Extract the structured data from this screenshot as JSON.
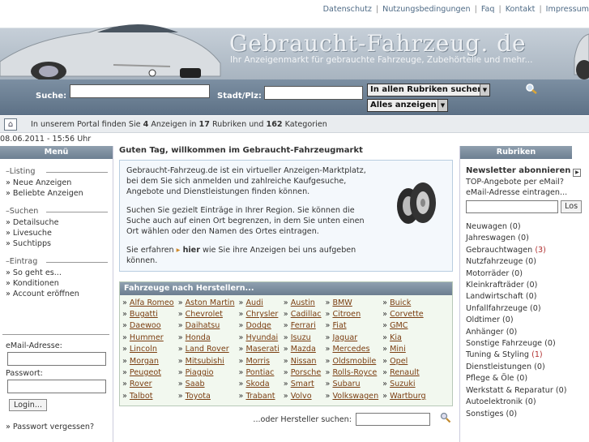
{
  "toplinks": [
    "Datenschutz",
    "Nutzungsbedingungen",
    "Faq",
    "Kontakt",
    "Impressum"
  ],
  "header": {
    "title": "Gebraucht-Fahrzeug. de",
    "subtitle": "Ihr Anzeigenmarkt für gebrauchte Fahrzeuge, Zubehörteile und mehr..."
  },
  "search": {
    "label": "Suche:",
    "city_label": "Stadt/Plz:",
    "rubric_select": "In allen Rubriken suchen",
    "show_select": "Alles anzeigen"
  },
  "info": {
    "pre": "In unserem Portal finden Sie ",
    "ads": "4",
    "mid1": " Anzeigen in ",
    "rubrics": "17",
    "mid2": " Rubriken und ",
    "categories": "162",
    "post": " Kategorien"
  },
  "datetime": "08.06.2011 - 15:56 Uhr",
  "left": {
    "header": "Menü",
    "groups": [
      {
        "title": "Listing",
        "items": [
          "Neue Anzeigen",
          "Beliebte Anzeigen"
        ]
      },
      {
        "title": "Suchen",
        "items": [
          "Detailsuche",
          "Livesuche",
          "Suchtipps"
        ]
      },
      {
        "title": "Eintrag",
        "items": [
          "So geht es...",
          "Konditionen",
          "Account eröffnen"
        ]
      }
    ],
    "email_label": "eMail-Adresse:",
    "password_label": "Passwort:",
    "login_button": "Login...",
    "forgot": "Passwort vergessen?"
  },
  "main": {
    "greeting": "Guten Tag, willkommen im Gebraucht-Fahrzeugmarkt",
    "p1": "Gebraucht-Fahrzeug.de ist ein virtueller Anzeigen-Marktplatz, bei dem Sie sich anmelden und zahlreiche Kaufgesuche, Angebote und Dienstleistungen finden können.",
    "p2": "Suchen Sie gezielt Einträge in Ihrer Region. Sie können die Suche auch auf einen Ort begrenzen, in dem Sie unten einen Ort wählen oder den Namen des Ortes eintragen.",
    "p3_pre": "Sie erfahren ",
    "p3_link": "hier",
    "p3_post": " wie Sie ihre Anzeigen bei uns aufgeben können.",
    "mfr_header": "Fahrzeuge nach Herstellern...",
    "manufacturers": [
      [
        "Alfa Romeo",
        "Aston Martin",
        "Audi",
        "Austin",
        "BMW",
        "Buick"
      ],
      [
        "Bugatti",
        "Chevrolet",
        "Chrysler",
        "Cadillac",
        "Citroen",
        "Corvette"
      ],
      [
        "Daewoo",
        "Daihatsu",
        "Dodge",
        "Ferrari",
        "Fiat",
        "GMC"
      ],
      [
        "Hummer",
        "Honda",
        "Hyundai",
        "Isuzu",
        "Jaguar",
        "Kia"
      ],
      [
        "Lincoln",
        "Land Rover",
        "Maserati",
        "Mazda",
        "Mercedes",
        "Mini"
      ],
      [
        "Morgan",
        "Mitsubishi",
        "Morris",
        "Nissan",
        "Oldsmobile",
        "Opel"
      ],
      [
        "Peugeot",
        "Piaggio",
        "Pontiac",
        "Porsche",
        "Rolls-Royce",
        "Renault"
      ],
      [
        "Rover",
        "Saab",
        "Skoda",
        "Smart",
        "Subaru",
        "Suzuki"
      ],
      [
        "Talbot",
        "Toyota",
        "Trabant",
        "Volvo",
        "Volkswagen",
        "Wartburg"
      ]
    ],
    "other_label": "...oder Hersteller suchen:"
  },
  "right": {
    "header": "Rubriken",
    "newsletter_title": "Newsletter abonnieren",
    "newsletter_text1": "TOP-Angebote per eMail?",
    "newsletter_text2": "eMail-Adresse eintragen...",
    "los_button": "Los",
    "categories": [
      {
        "name": "Neuwagen",
        "count": "(0)"
      },
      {
        "name": "Jahreswagen",
        "count": "(0)"
      },
      {
        "name": "Gebrauchtwagen",
        "count": "(3)"
      },
      {
        "name": "Nutzfahrzeuge",
        "count": "(0)"
      },
      {
        "name": "Motorräder",
        "count": "(0)"
      },
      {
        "name": "Kleinkrafträder",
        "count": "(0)"
      },
      {
        "name": "Landwirtschaft",
        "count": "(0)"
      },
      {
        "name": "Unfallfahrzeuge",
        "count": "(0)"
      },
      {
        "name": "Oldtimer",
        "count": "(0)"
      },
      {
        "name": "Anhänger",
        "count": "(0)"
      },
      {
        "name": "Sonstige Fahrzeuge",
        "count": "(0)"
      },
      {
        "name": "Tuning & Styling",
        "count": "(1)"
      },
      {
        "name": "Dienstleistungen",
        "count": "(0)"
      },
      {
        "name": "Pflege & Öle",
        "count": "(0)"
      },
      {
        "name": "Werkstatt & Reparatur",
        "count": "(0)"
      },
      {
        "name": "Autoelektronik",
        "count": "(0)"
      },
      {
        "name": "Sonstiges",
        "count": "(0)"
      }
    ]
  }
}
